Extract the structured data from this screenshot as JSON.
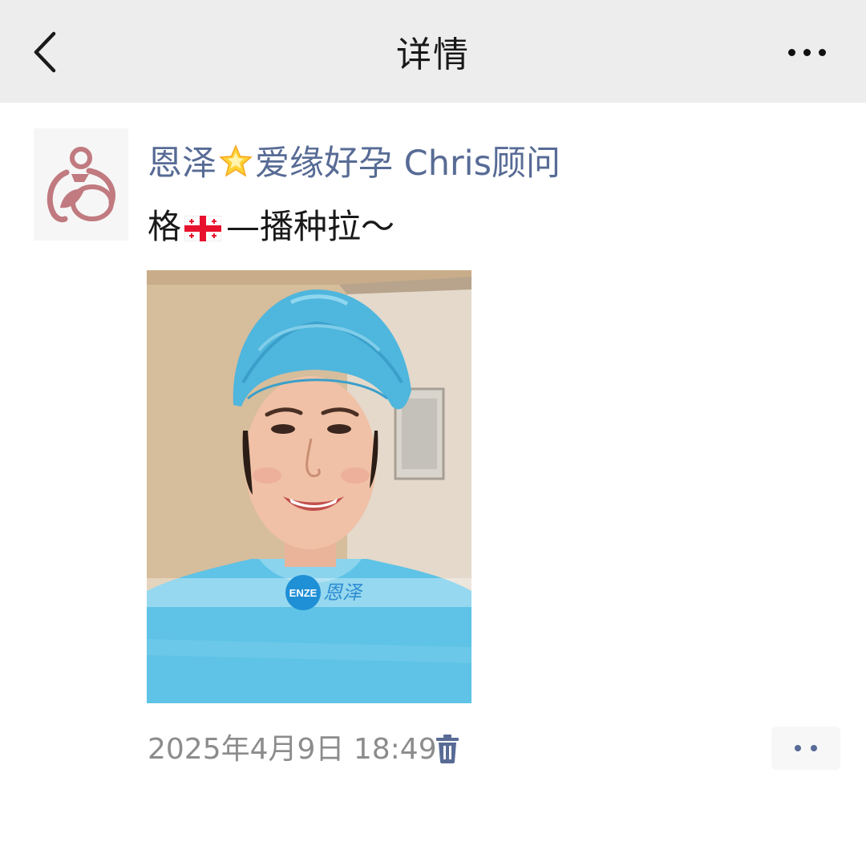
{
  "navbar": {
    "title": "详情",
    "back_icon": "chevron-left-icon",
    "more_icon": "more-dots-icon"
  },
  "post": {
    "avatar_icon": "enze-logo-icon",
    "nickname_prefix": "恩泽",
    "nickname_emoji": "star-emoji",
    "nickname_suffix": "爱缘好孕 Chris顾问",
    "text_prefix": "格",
    "text_emoji": "georgia-flag-emoji",
    "text_suffix": "—播种拉～",
    "photo": {
      "description_icon": "photo",
      "watermark_badge": "ENZE",
      "watermark_text": "恩泽"
    },
    "timestamp": "2025年4月9日 18:49",
    "delete_icon": "trash-icon",
    "comment_icon": "comment-dots-icon"
  },
  "colors": {
    "navbar_bg": "#ededed",
    "nickname": "#576b95",
    "timestamp": "#8c8c8c",
    "logo": "#c07a80"
  }
}
